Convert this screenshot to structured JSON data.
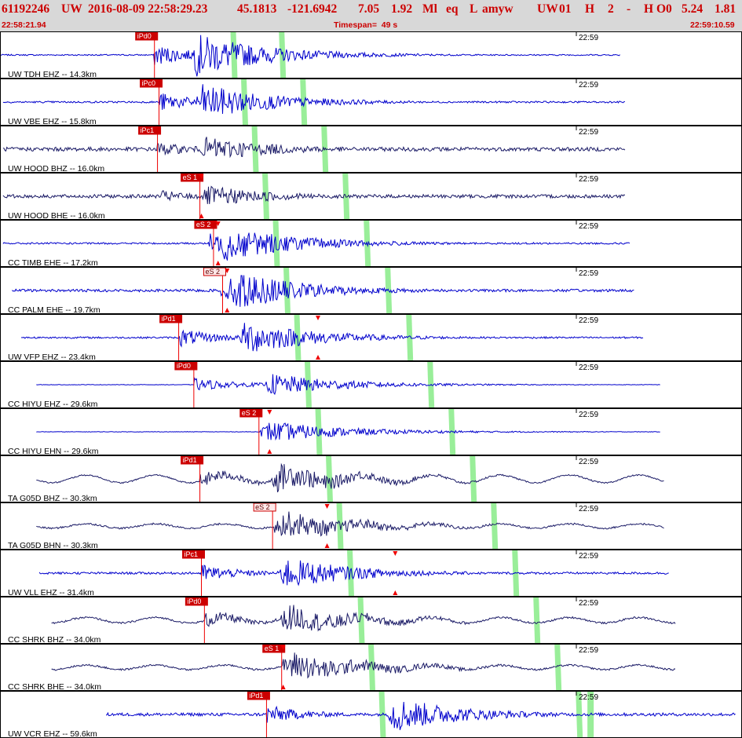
{
  "header": {
    "event_id": "61192246",
    "network": "UW",
    "datetime": "2016-08-09 22:58:29.23",
    "lat": "45.1813",
    "lon": "-121.6942",
    "depth": "7.05",
    "magnitude": "1.92",
    "mag_type": "Ml",
    "event_type": "eq",
    "review": "L",
    "author": "amyw",
    "origin_net": "UW",
    "version": "01",
    "flag_h": "H",
    "count": "2",
    "dash": "-",
    "flag_h2": "H",
    "origin_code": "O0",
    "val1": "5.24",
    "val2": "1.81",
    "start_time": "22:58:21.94",
    "timespan": "Timespan=  49 s",
    "end_time": "22:59:10.59"
  },
  "chart_data": {
    "type": "line",
    "title": "",
    "x_axis": {
      "start": "22:58:21.94",
      "end": "22:59:10.59",
      "timespan_s": 49,
      "minute_tick_label": "22:59",
      "minute_tick_s": 38.06
    },
    "colors": {
      "trace_ehz": "#0000cc",
      "trace_bh": "#1a1a66",
      "pick": "#ee0000",
      "pick_box": "#cc0000",
      "ray_band": "#99ee99",
      "frame": "#000000",
      "label": "#000000"
    },
    "ray_bands": [
      {
        "p_start_s": 15.4,
        "p_step_s": 0.7,
        "s_start_s": 18.6,
        "s_step_s": 1.4
      },
      {
        "p_start_s": 15.6,
        "p_step_s": 0.71,
        "s_start_s": 19.1,
        "s_step_s": 1.4
      },
      {
        "s_end_s": 39.0
      }
    ],
    "series": [
      {
        "station": "UW TDH EHZ -- 14.3km",
        "kind": "ehz",
        "start_s": 0.0,
        "end_s": 41.0,
        "onset_s": 10.2,
        "s_s": 12.6,
        "amp": 1.0,
        "noise": 0.03,
        "pre_wave": 0,
        "picks": [
          {
            "label": "iPd0",
            "t": 10.2,
            "style": "solid"
          }
        ],
        "markers": []
      },
      {
        "station": "UW VBE EHZ -- 15.8km",
        "kind": "ehz",
        "start_s": 0.2,
        "end_s": 41.3,
        "onset_s": 10.5,
        "s_s": 12.9,
        "amp": 0.85,
        "noise": 0.04,
        "pre_wave": 0,
        "picks": [
          {
            "label": "iPc0",
            "t": 10.5,
            "style": "solid"
          }
        ],
        "markers": []
      },
      {
        "station": "UW HOOD BHZ -- 16.0km",
        "kind": "bh",
        "start_s": 0.2,
        "end_s": 41.3,
        "onset_s": 10.4,
        "s_s": 13.2,
        "amp": 0.55,
        "noise": 0.09,
        "pre_wave": 0,
        "picks": [
          {
            "label": "iPc1",
            "t": 10.4,
            "style": "solid"
          }
        ],
        "markers": []
      },
      {
        "station": "UW HOOD BHE -- 16.0km",
        "kind": "bh",
        "start_s": 0.2,
        "end_s": 41.3,
        "onset_s": 10.6,
        "s_s": 13.3,
        "amp": 0.45,
        "noise": 0.08,
        "pre_wave": 0,
        "picks": [
          {
            "label": "eS 1",
            "t": 13.2,
            "style": "solid"
          }
        ],
        "markers": [
          13.3
        ]
      },
      {
        "station": "CC TIMB EHE -- 17.2km",
        "kind": "ehz",
        "start_s": 0.2,
        "end_s": 41.6,
        "onset_s": 13.8,
        "s_s": 14.4,
        "amp": 0.85,
        "noise": 0.04,
        "pre_wave": 0,
        "picks": [
          {
            "label": "eS 2",
            "t": 14.1,
            "style": "solid"
          }
        ],
        "markers": [
          14.4
        ]
      },
      {
        "station": "CC PALM EHE -- 19.7km",
        "kind": "ehz",
        "start_s": 0.8,
        "end_s": 41.9,
        "onset_s": 14.6,
        "s_s": 15.0,
        "amp": 0.9,
        "noise": 0.06,
        "pre_wave": 0,
        "picks": [
          {
            "label": "eS 2",
            "t": 14.7,
            "style": "open"
          }
        ],
        "markers": [
          15.0
        ]
      },
      {
        "station": "UW VFP EHZ -- 23.4km",
        "kind": "ehz",
        "start_s": 1.4,
        "end_s": 42.5,
        "onset_s": 11.8,
        "s_s": 15.8,
        "amp": 0.8,
        "noise": 0.04,
        "pre_wave": 0,
        "picks": [
          {
            "label": "iPd1",
            "t": 11.8,
            "style": "solid"
          }
        ],
        "markers": [
          21.0
        ]
      },
      {
        "station": "CC HIYU EHZ -- 29.6km",
        "kind": "ehz",
        "start_s": 2.4,
        "end_s": 43.6,
        "onset_s": 12.8,
        "s_s": 17.5,
        "amp": 0.5,
        "noise": 0.01,
        "pre_wave": 0,
        "picks": [
          {
            "label": "iPd0",
            "t": 12.8,
            "style": "solid"
          }
        ],
        "markers": []
      },
      {
        "station": "CC HIYU EHN -- 29.6km",
        "kind": "ehz",
        "start_s": 2.4,
        "end_s": 43.6,
        "onset_s": 17.2,
        "s_s": 17.4,
        "amp": 0.45,
        "noise": 0.01,
        "pre_wave": 0,
        "picks": [
          {
            "label": "eS 2",
            "t": 17.1,
            "style": "solid"
          }
        ],
        "markers": [
          17.8
        ]
      },
      {
        "station": "TA G05D BHZ -- 30.3km",
        "kind": "bh",
        "start_s": 2.4,
        "end_s": 43.9,
        "onset_s": 13.2,
        "s_s": 17.9,
        "amp": 0.65,
        "noise": 0.03,
        "pre_wave": 0.35,
        "picks": [
          {
            "label": "iPd1",
            "t": 13.2,
            "style": "solid"
          }
        ],
        "markers": []
      },
      {
        "station": "TA G05D BHN -- 30.3km",
        "kind": "bh",
        "start_s": 2.4,
        "end_s": 43.9,
        "onset_s": 18.1,
        "s_s": 18.3,
        "amp": 0.6,
        "noise": 0.04,
        "pre_wave": 0.2,
        "picks": [
          {
            "label": "eS 2",
            "t": 18.0,
            "style": "open"
          }
        ],
        "markers": [
          21.6
        ]
      },
      {
        "station": "UW VLL EHZ -- 31.4km",
        "kind": "ehz",
        "start_s": 2.6,
        "end_s": 44.2,
        "onset_s": 13.3,
        "s_s": 18.4,
        "amp": 0.75,
        "noise": 0.05,
        "pre_wave": 0,
        "picks": [
          {
            "label": "iPc1",
            "t": 13.3,
            "style": "solid"
          }
        ],
        "markers": [
          26.1
        ]
      },
      {
        "station": "CC SHRK BHZ -- 34.0km",
        "kind": "bh",
        "start_s": 3.4,
        "end_s": 44.6,
        "onset_s": 13.5,
        "s_s": 18.5,
        "amp": 0.65,
        "noise": 0.04,
        "pre_wave": 0.25,
        "picks": [
          {
            "label": "iPd0",
            "t": 13.5,
            "style": "solid"
          }
        ],
        "markers": []
      },
      {
        "station": "CC SHRK BHE -- 34.0km",
        "kind": "bh",
        "start_s": 3.4,
        "end_s": 44.6,
        "onset_s": 18.7,
        "s_s": 18.8,
        "amp": 0.65,
        "noise": 0.04,
        "pre_wave": 0.2,
        "picks": [
          {
            "label": "eS 1",
            "t": 18.6,
            "style": "solid"
          }
        ],
        "markers": [
          18.7
        ]
      },
      {
        "station": "UW VCR EHZ -- 59.6km",
        "kind": "ehz",
        "start_s": 7.0,
        "end_s": 48.6,
        "onset_s": 17.6,
        "s_s": 25.6,
        "amp": 0.85,
        "noise": 0.07,
        "pre_wave": 0,
        "picks": [
          {
            "label": "iPd1",
            "t": 17.6,
            "style": "solid"
          }
        ],
        "markers": []
      }
    ]
  }
}
